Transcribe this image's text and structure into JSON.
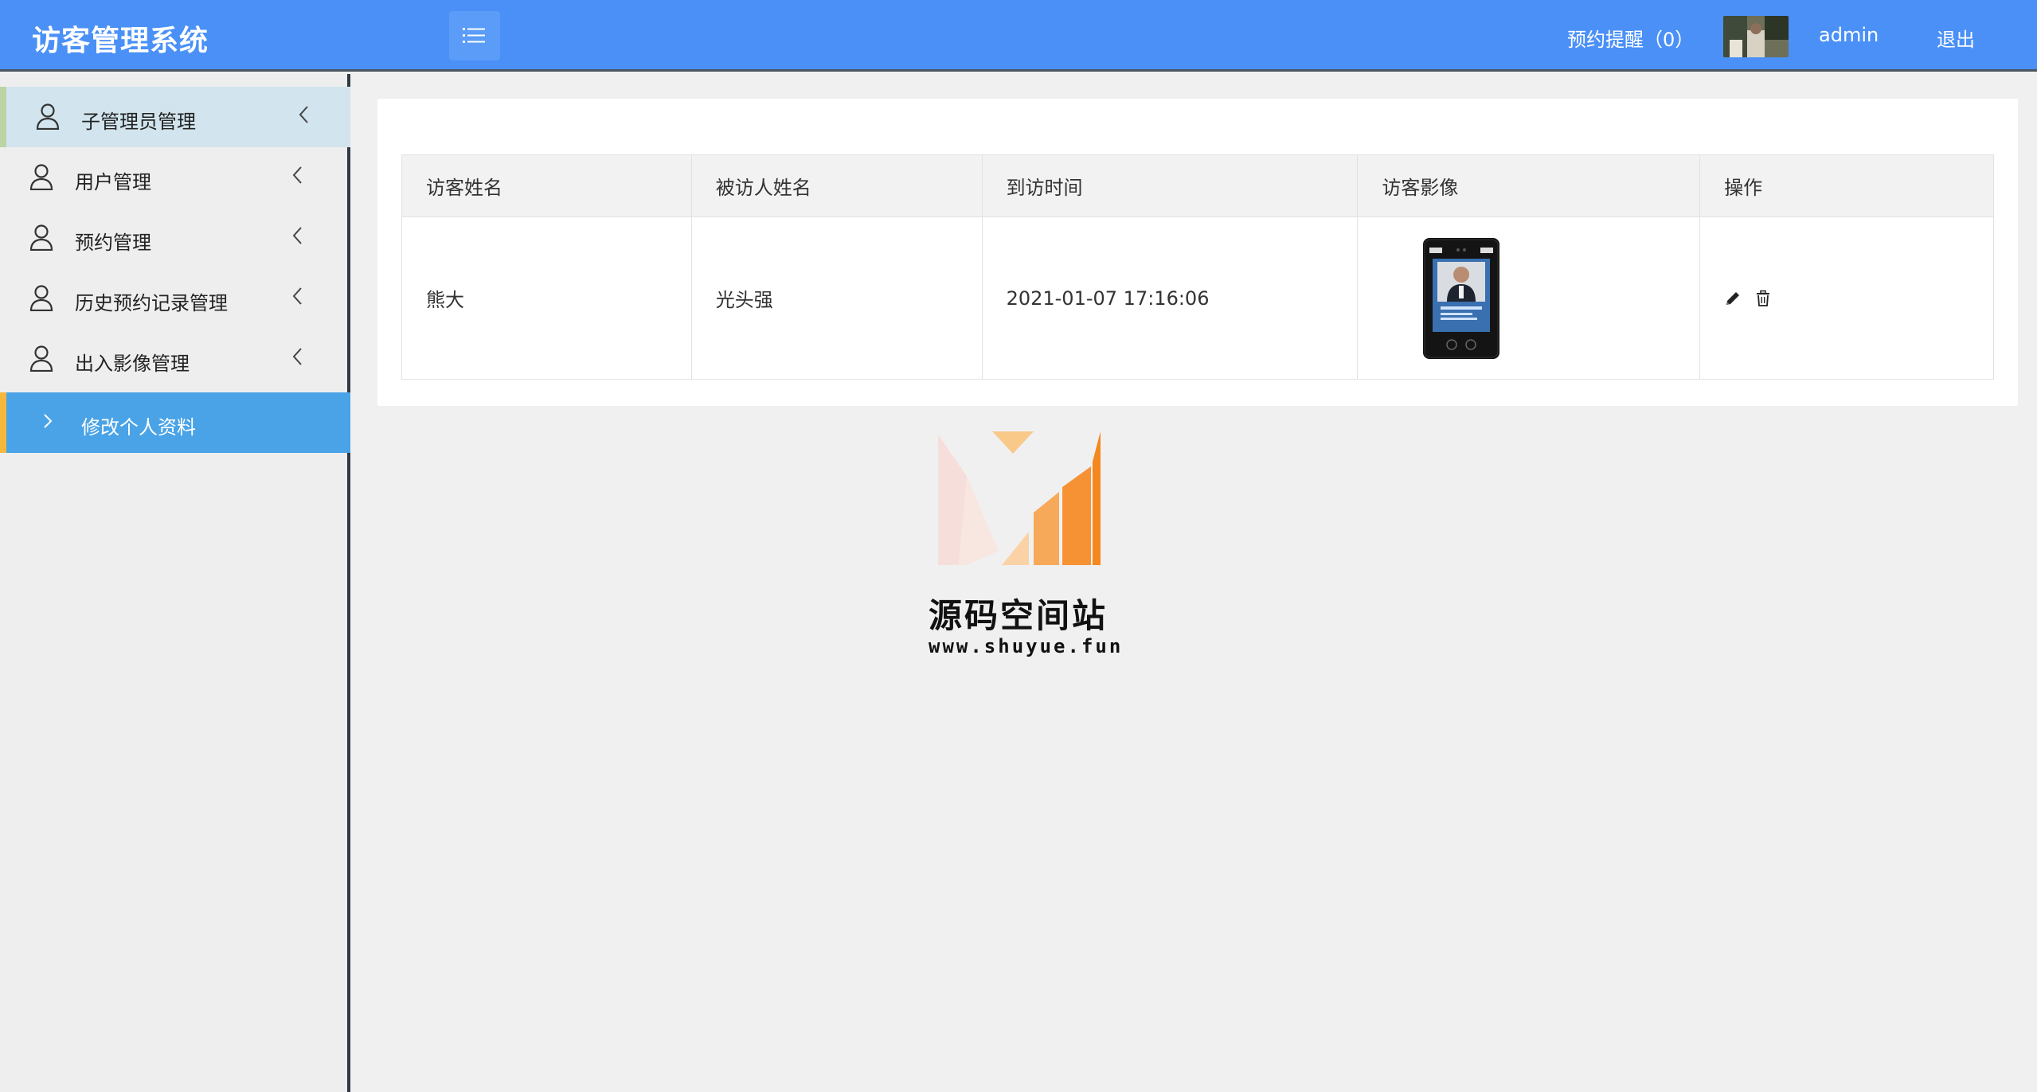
{
  "header": {
    "title": "访客管理系统",
    "reminder": "预约提醒（0）",
    "username": "admin",
    "logout": "退出"
  },
  "sidebar": {
    "items": [
      {
        "label": "子管理员管理",
        "icon": "user-icon"
      },
      {
        "label": "用户管理",
        "icon": "user-icon"
      },
      {
        "label": "预约管理",
        "icon": "user-icon"
      },
      {
        "label": "历史预约记录管理",
        "icon": "user-icon"
      },
      {
        "label": "出入影像管理",
        "icon": "user-icon"
      },
      {
        "label": "修改个人资料",
        "icon": "chevron-right-icon"
      }
    ]
  },
  "table": {
    "headers": [
      "访客姓名",
      "被访人姓名",
      "到访时间",
      "访客影像",
      "操作"
    ],
    "rows": [
      {
        "visitor": "熊大",
        "host": "光头强",
        "time": "2021-01-07 17:16:06",
        "image": "face-recognition-device-photo"
      }
    ]
  },
  "watermark": {
    "name": "源码空间站",
    "url": "www.shuyue.fun"
  },
  "colors": {
    "header": "#4a90f7",
    "active_item": "#4aa3e6",
    "active_border": "#f5b83d",
    "hover_item": "#d2e5ee",
    "logo_orange": "#f5871f"
  }
}
